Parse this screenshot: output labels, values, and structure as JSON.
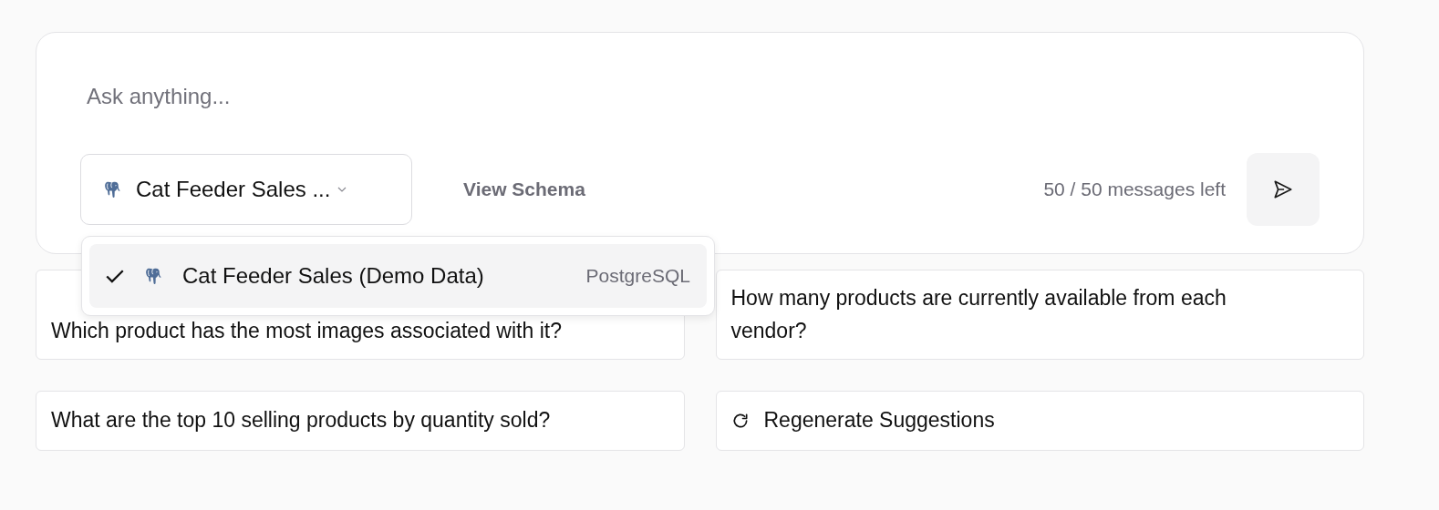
{
  "composer": {
    "placeholder": "Ask anything...",
    "database_select": {
      "label": "Cat Feeder Sales ...",
      "expanded": true
    },
    "view_schema": "View Schema",
    "counter": "50 / 50 messages left"
  },
  "dropdown": {
    "options": [
      {
        "name": "Cat Feeder Sales (Demo Data)",
        "type": "PostgreSQL",
        "selected": true
      }
    ]
  },
  "suggestions": [
    {
      "kind": "question",
      "text": "Which product has the most images associated with it?"
    },
    {
      "kind": "question",
      "text": "How many products are currently available from each vendor?"
    },
    {
      "kind": "question",
      "text": "What are the top 10 selling products by quantity sold?"
    },
    {
      "kind": "action",
      "text": "Regenerate Suggestions"
    }
  ]
}
